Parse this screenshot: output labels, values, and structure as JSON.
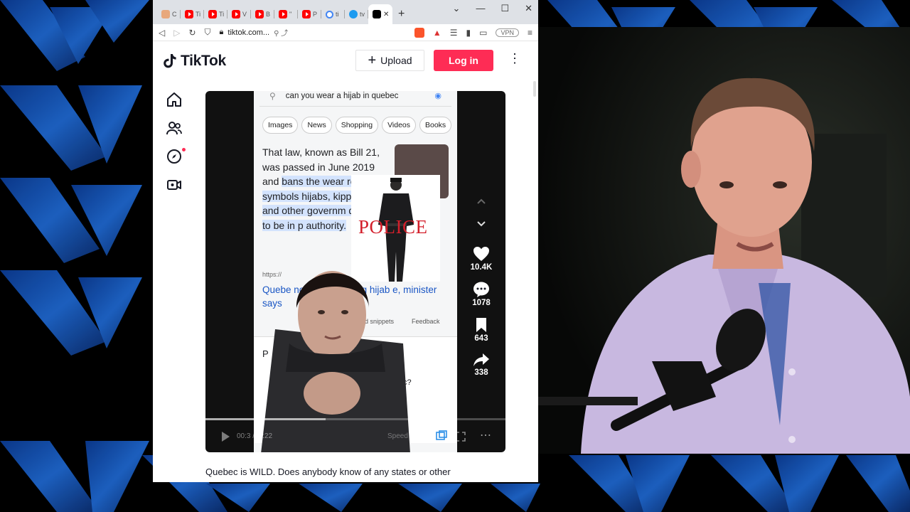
{
  "browser": {
    "tabs": [
      {
        "favicon": "misc",
        "label": "C"
      },
      {
        "favicon": "youtube",
        "label": "Ti"
      },
      {
        "favicon": "youtube",
        "label": "Ti"
      },
      {
        "favicon": "youtube",
        "label": "V"
      },
      {
        "favicon": "youtube",
        "label": "B"
      },
      {
        "favicon": "youtube",
        "label": "\""
      },
      {
        "favicon": "youtube",
        "label": "P"
      },
      {
        "favicon": "google",
        "label": "ti"
      },
      {
        "favicon": "twitter",
        "label": "tv"
      },
      {
        "favicon": "tiktok",
        "label": ""
      }
    ],
    "url": "tiktok.com...",
    "vpn_label": "VPN"
  },
  "tiktok": {
    "logo_text": "TikTok",
    "upload_label": "Upload",
    "login_label": "Log in",
    "caption": "Quebec is WILD. Does anybody know of any states or other"
  },
  "video": {
    "search_query": "can you wear a hijab in quebec",
    "chips": [
      "Images",
      "News",
      "Shopping",
      "Videos",
      "Books"
    ],
    "snippet_plain_1": "That law, known as Bill 21, was passed in June 2019 and ",
    "snippet_highlight": "bans the wear religious symbols hijabs, kippas and and other governm deemed to be in p authority.",
    "overlay_word": "POLICE",
    "source_url": "https://",
    "result_title": "Quebe          noval for wearing hijab            e, minister says",
    "featured_label": "red snippets",
    "feedback_label": "Feedback",
    "paa_label": "P",
    "paa_question": "c?",
    "time": "00:3  /02:22",
    "speed_label": "Speed",
    "progress": 0.4,
    "likes": "10.4K",
    "comments": "1078",
    "saves": "643",
    "shares": "338"
  },
  "colors": {
    "tiktok_red": "#fe2c55",
    "link_blue": "#1a56c4",
    "highlight": "#d3e3fd",
    "police_red": "#d31f2b"
  }
}
